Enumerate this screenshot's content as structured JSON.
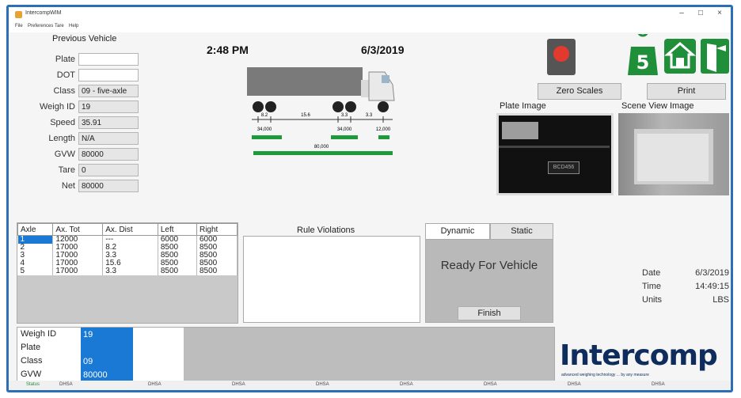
{
  "window": {
    "title": "IntercompWIM"
  },
  "menu": [
    "File",
    "Preferences",
    "Tare",
    "Help"
  ],
  "previous_vehicle": {
    "title": "Previous Vehicle",
    "fields": [
      {
        "label": "Plate",
        "value": ""
      },
      {
        "label": "DOT",
        "value": ""
      },
      {
        "label": "Class",
        "value": "09 - five-axle"
      },
      {
        "label": "Weigh ID",
        "value": "19"
      },
      {
        "label": "Speed",
        "value": "35.91"
      },
      {
        "label": "Length",
        "value": "N/A"
      },
      {
        "label": "GVW",
        "value": "80000"
      },
      {
        "label": "Tare",
        "value": "0"
      },
      {
        "label": "Net",
        "value": "80000"
      }
    ]
  },
  "clock": {
    "time": "2:48 PM",
    "date": "6/3/2019"
  },
  "truck": {
    "spacing_labels": [
      "8.2",
      "15.6",
      "3.3",
      "3.3"
    ],
    "group_weights": [
      "34,000",
      "34,000",
      "12,000"
    ],
    "total_weight": "80,000"
  },
  "buttons": {
    "zero_scales": "Zero Scales",
    "print": "Print",
    "finish": "Finish"
  },
  "images": {
    "plate_label": "Plate Image",
    "scene_label": "Scene View Image",
    "plate_text": "BCD456"
  },
  "axle_table": {
    "headers": [
      "Axle",
      "Ax. Tot",
      "Ax. Dist",
      "Left",
      "Right"
    ],
    "rows": [
      [
        "1",
        "12000",
        "---",
        "6000",
        "6000"
      ],
      [
        "2",
        "17000",
        "8.2",
        "8500",
        "8500"
      ],
      [
        "3",
        "17000",
        "3.3",
        "8500",
        "8500"
      ],
      [
        "4",
        "17000",
        "15.6",
        "8500",
        "8500"
      ],
      [
        "5",
        "17000",
        "3.3",
        "8500",
        "8500"
      ]
    ]
  },
  "rule_violations": {
    "title": "Rule Violations"
  },
  "mode_tabs": {
    "dynamic": "Dynamic",
    "static": "Static",
    "status": "Ready For Vehicle"
  },
  "info": [
    {
      "label": "Date",
      "value": "6/3/2019"
    },
    {
      "label": "Time",
      "value": "14:49:15"
    },
    {
      "label": "Units",
      "value": "LBS"
    }
  ],
  "bottom_weigh": [
    {
      "label": "Weigh ID",
      "value": "19"
    },
    {
      "label": "Plate",
      "value": ""
    },
    {
      "label": "Class",
      "value": "09"
    },
    {
      "label": "GVW",
      "value": "80000"
    }
  ],
  "logo": {
    "name": "Intercomp",
    "tagline": "advanced weighing technology ... by any measure"
  },
  "statusbar": [
    "Status",
    "DHSA",
    "DHSA",
    "DHSA",
    "DHSA",
    "DHSA",
    "DHSA",
    "DHSA",
    "DHSA"
  ],
  "colors": {
    "border": "#2d6fb5",
    "selected": "#1a79d4",
    "icon_green": "#1f8f3a",
    "brand": "#0f2d5c"
  }
}
